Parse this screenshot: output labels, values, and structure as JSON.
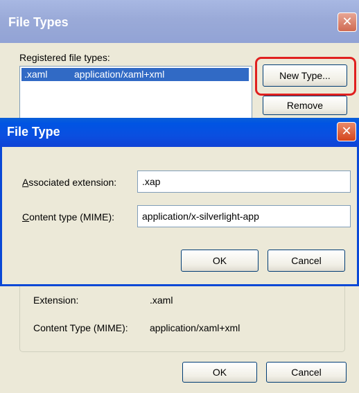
{
  "background_dialog": {
    "title": "File Types",
    "registered_label": "Registered file types:",
    "file_list": [
      {
        "extension": ".xaml",
        "mime": "application/xaml+xml",
        "selected": true
      }
    ],
    "new_type_label": "New Type...",
    "remove_label": "Remove",
    "details": {
      "extension_label": "Extension:",
      "extension_value": ".xaml",
      "content_type_label": "Content Type (MIME):",
      "content_type_value": "application/xaml+xml"
    },
    "ok_label": "OK",
    "cancel_label": "Cancel"
  },
  "file_type_dialog": {
    "title": "File Type",
    "associated_extension_label_prefix": "A",
    "associated_extension_label_rest": "ssociated extension:",
    "associated_extension_value": ".xap",
    "content_type_label_prefix": "C",
    "content_type_label_rest": "ontent type (MIME):",
    "content_type_value": "application/x-silverlight-app",
    "ok_label": "OK",
    "cancel_label": "Cancel"
  },
  "icons": {
    "close": "close-icon"
  },
  "colors": {
    "highlight_ring": "#e0201f",
    "active_titlebar": "#0054e3",
    "inactive_titlebar": "#9aaad8",
    "selection": "#316ac5"
  }
}
